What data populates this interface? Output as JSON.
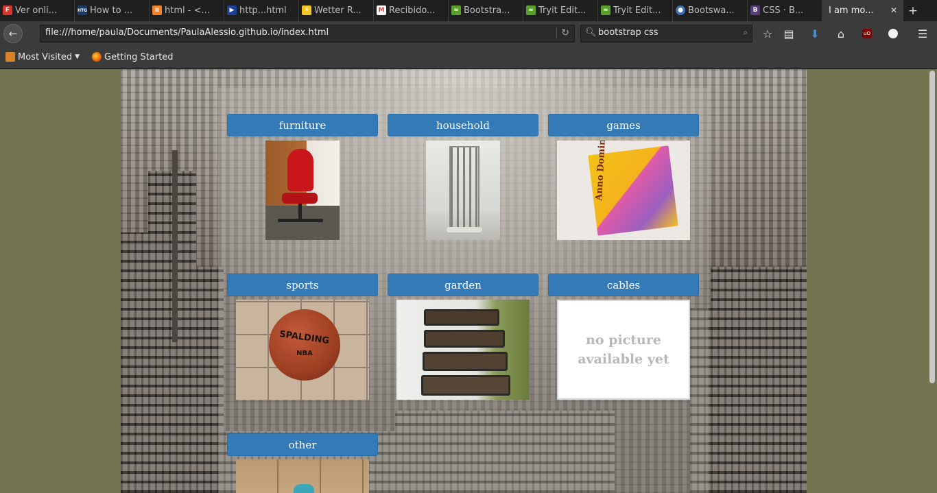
{
  "browser": {
    "tabs": [
      {
        "label": "Ver onli...",
        "fav_color": "#d9362c",
        "fav_glyph": "F"
      },
      {
        "label": "How to ...",
        "fav_color": "#1a3a6a",
        "fav_glyph": "HTG"
      },
      {
        "label": "html - <...",
        "fav_color": "#f48024",
        "fav_glyph": "≡"
      },
      {
        "label": "http...html",
        "fav_color": "#1d3f99",
        "fav_glyph": "▶"
      },
      {
        "label": "Wetter R...",
        "fav_color": "#f2c522",
        "fav_glyph": "☀"
      },
      {
        "label": "Recibido...",
        "fav_color": "#d44638",
        "fav_glyph": "M"
      },
      {
        "label": "Bootstra...",
        "fav_color": "#5aa02c",
        "fav_glyph": "≈"
      },
      {
        "label": "Tryit Edit...",
        "fav_color": "#5aa02c",
        "fav_glyph": "≈"
      },
      {
        "label": "Tryit Edit...",
        "fav_color": "#5aa02c",
        "fav_glyph": "≈"
      },
      {
        "label": "Bootswa...",
        "fav_color": "#3d6fb5",
        "fav_glyph": "●"
      },
      {
        "label": "CSS · B...",
        "fav_color": "#563d7c",
        "fav_glyph": "B"
      }
    ],
    "active_tab": {
      "label": "I am mo...",
      "close": "✕"
    },
    "new_tab": "+",
    "url": "file:///home/paula/Documents/PaulaAlessio.github.io/index.html",
    "search_value": "bootstrap css",
    "bookmarks": [
      {
        "label": "Most Visited",
        "icon_color": "#d9822b"
      },
      {
        "label": "Getting Started",
        "icon_color": "#e66000"
      }
    ]
  },
  "page": {
    "background_color": "#737550",
    "button_color": "#337ab7",
    "categories": [
      {
        "label": "furniture",
        "photo": "red-office-chair"
      },
      {
        "label": "household",
        "photo": "drying-rack"
      },
      {
        "label": "games",
        "photo": "anno-domini-box"
      },
      {
        "label": "sports",
        "photo": "spalding-basketball"
      },
      {
        "label": "garden",
        "photo": "planter-boxes"
      },
      {
        "label": "cables",
        "placeholder_line1": "no picture",
        "placeholder_line2": "available yet"
      },
      {
        "label": "other",
        "photo": "other-item"
      }
    ],
    "game_box_text": "Anno Domini",
    "ball_text": "SPALDING",
    "ball_subtext": "NBA"
  }
}
